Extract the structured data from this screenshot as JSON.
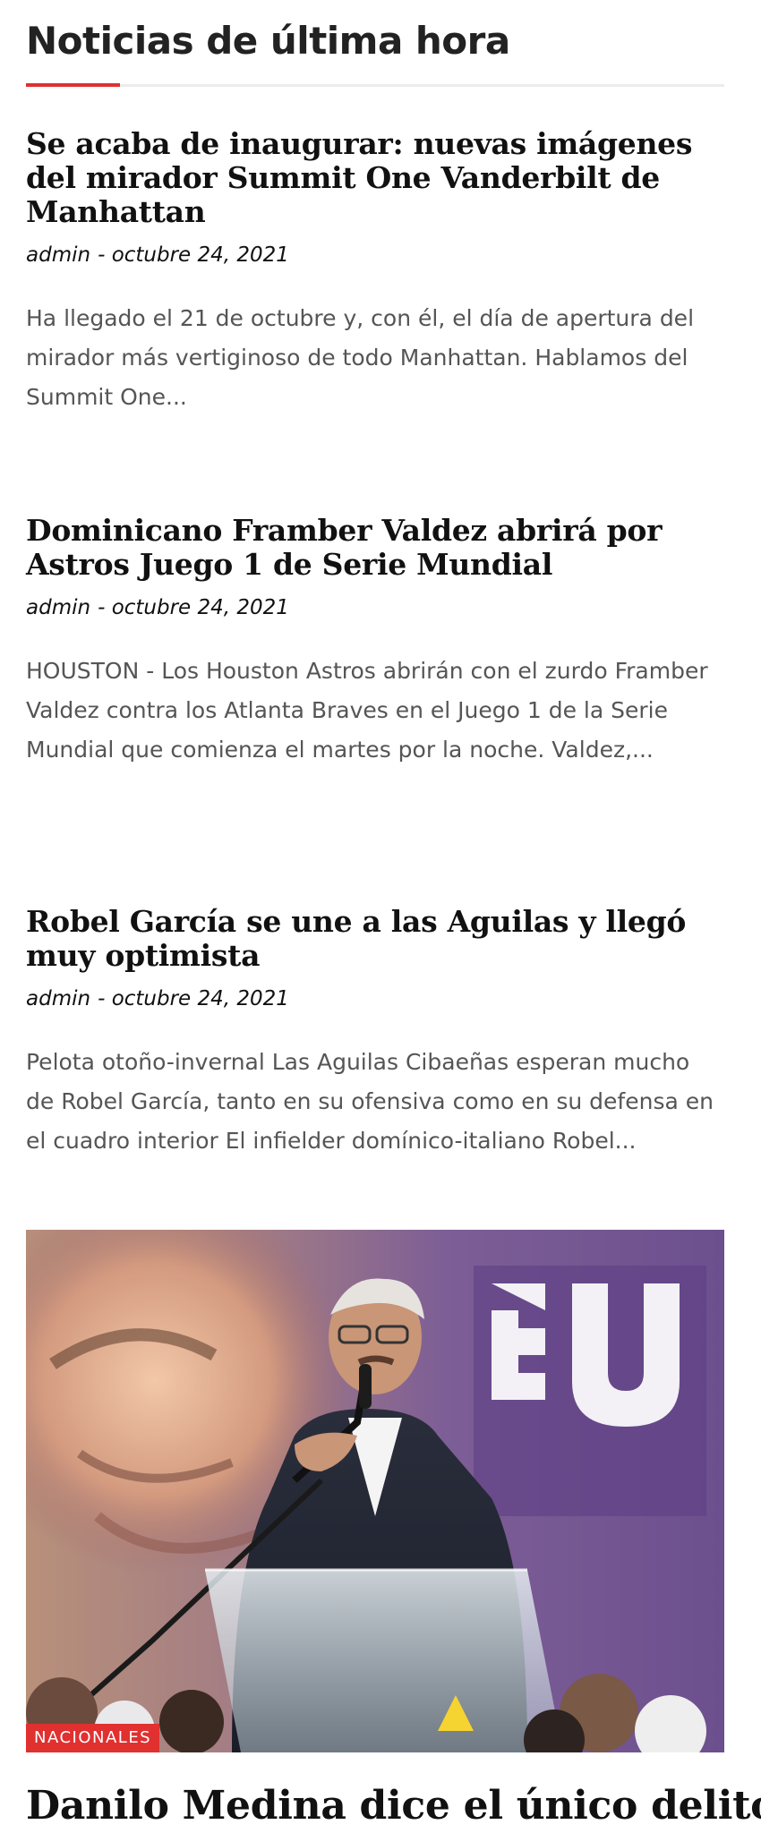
{
  "section": {
    "title": "Noticias de última hora"
  },
  "articles": [
    {
      "title": "Se acaba de inaugurar: nuevas imágenes del mirador Summit One Vanderbilt de Manhattan",
      "author": "admin",
      "date": "- octubre 24, 2021",
      "excerpt": "Ha llegado el 21 de octubre y, con él, el día de apertura del mirador más vertiginoso de todo Manhattan. Hablamos del Summit One..."
    },
    {
      "title": "Dominicano Framber Valdez abrirá por Astros Juego 1 de Serie Mundial",
      "author": "admin",
      "date": "- octubre 24, 2021",
      "excerpt": "HOUSTON - Los Houston Astros abrirán con el zurdo Framber Valdez contra los Atlanta Braves en el Juego 1 de la Serie Mundial que comienza el martes por la noche. Valdez,..."
    },
    {
      "title": "Robel García se une a las Aguilas y llegó muy optimista",
      "author": "admin",
      "date": "- octubre 24, 2021",
      "excerpt": "Pelota otoño-invernal Las Aguilas Cibaeñas esperan mucho de Robel García, tanto en su ofensiva como en su defensa en el cuadro interior El infielder domínico-italiano Robel..."
    }
  ],
  "featured": {
    "category": "NACIONALES",
    "title": "Danilo Medina dice el único delito"
  },
  "colors": {
    "accent": "#e03030",
    "text": "#111111",
    "excerpt": "#555555",
    "divider": "#ececec"
  }
}
